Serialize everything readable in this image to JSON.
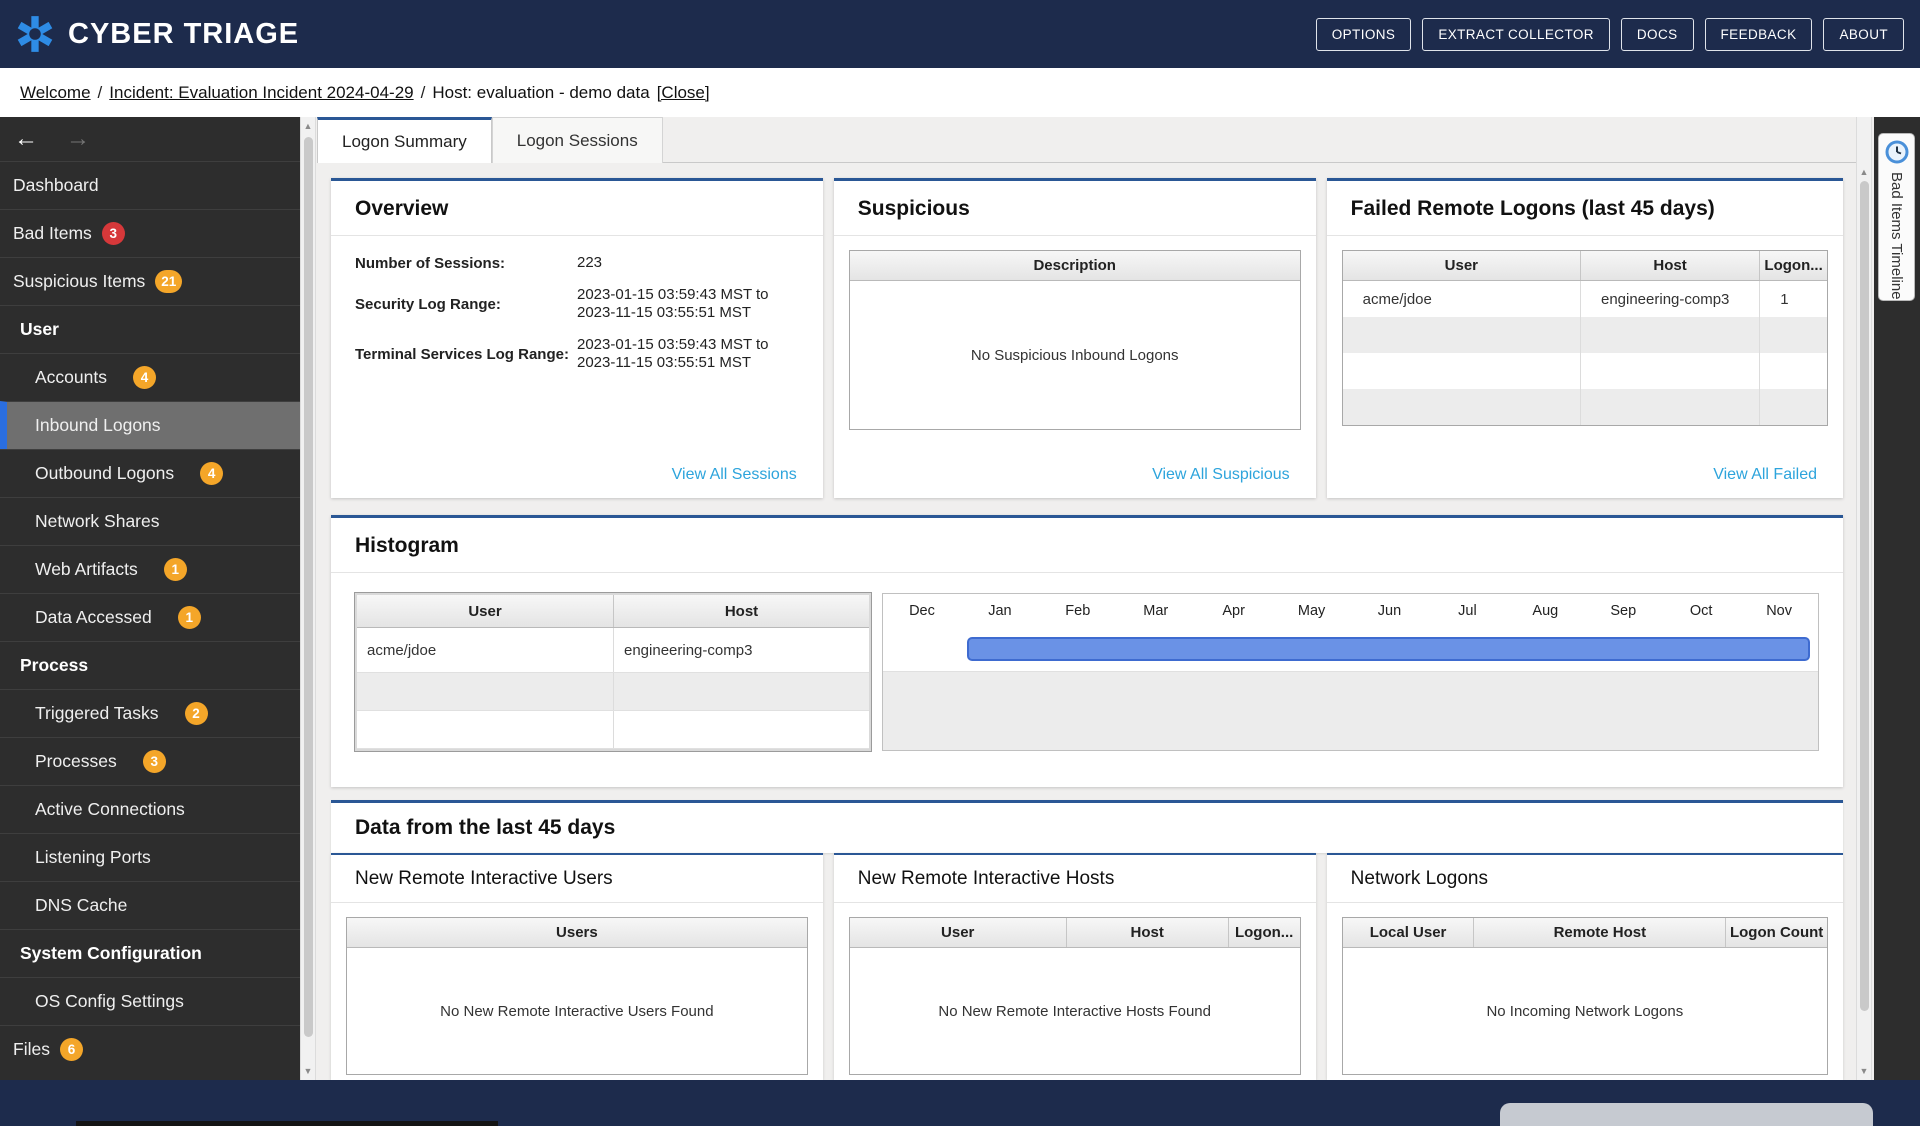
{
  "header": {
    "app_title": "CYBER TRIAGE",
    "buttons": [
      "OPTIONS",
      "EXTRACT COLLECTOR",
      "DOCS",
      "FEEDBACK",
      "ABOUT"
    ]
  },
  "breadcrumb": {
    "welcome": "Welcome",
    "separator": "/",
    "incident": "Incident: Evaluation Incident 2024-04-29",
    "host": "Host: evaluation - demo data",
    "close": "[Close]"
  },
  "sidebar_nav": {
    "back_icon": "←",
    "forward_icon": "→"
  },
  "sidebar": {
    "items": [
      {
        "label": "Dashboard",
        "kind": "top"
      },
      {
        "label": "Bad Items",
        "kind": "top",
        "badge": "3",
        "badgeColor": "red"
      },
      {
        "label": "Suspicious Items",
        "kind": "top",
        "badge": "21",
        "badgeColor": "orange"
      },
      {
        "label": "User",
        "kind": "section"
      },
      {
        "label": "Accounts",
        "kind": "sub",
        "indent": true,
        "badge": "4",
        "badgeColor": "orange"
      },
      {
        "label": "Inbound Logons",
        "kind": "sub",
        "indent": true,
        "selected": true
      },
      {
        "label": "Outbound Logons",
        "kind": "sub",
        "indent": true,
        "badge": "4",
        "badgeColor": "orange"
      },
      {
        "label": "Network Shares",
        "kind": "sub",
        "indent": true
      },
      {
        "label": "Web Artifacts",
        "kind": "sub",
        "indent": true,
        "badge": "1",
        "badgeColor": "orange"
      },
      {
        "label": "Data Accessed",
        "kind": "sub",
        "indent": true,
        "badge": "1",
        "badgeColor": "orange"
      },
      {
        "label": "Process",
        "kind": "section"
      },
      {
        "label": "Triggered Tasks",
        "kind": "sub",
        "indent": true,
        "badge": "2",
        "badgeColor": "orange"
      },
      {
        "label": "Processes",
        "kind": "sub",
        "indent": true,
        "badge": "3",
        "badgeColor": "orange"
      },
      {
        "label": "Active Connections",
        "kind": "sub",
        "indent": true
      },
      {
        "label": "Listening Ports",
        "kind": "sub",
        "indent": true
      },
      {
        "label": "DNS Cache",
        "kind": "sub",
        "indent": true
      },
      {
        "label": "System Configuration",
        "kind": "section"
      },
      {
        "label": "OS Config Settings",
        "kind": "sub",
        "indent": true
      },
      {
        "label": "Files",
        "kind": "top",
        "badge": "6",
        "badgeColor": "orange"
      }
    ]
  },
  "tabs": [
    {
      "label": "Logon Summary",
      "active": true
    },
    {
      "label": "Logon Sessions",
      "active": false
    }
  ],
  "panels": {
    "overview": {
      "title": "Overview",
      "fields": [
        {
          "label": "Number of Sessions:",
          "lines": [
            "223"
          ]
        },
        {
          "label": "Security Log Range:",
          "lines": [
            "2023-01-15 03:59:43 MST to",
            "2023-11-15 03:55:51 MST"
          ]
        },
        {
          "label": "Terminal Services Log Range:",
          "lines": [
            "2023-01-15 03:59:43 MST to",
            "2023-11-15 03:55:51 MST"
          ]
        }
      ],
      "link": "View All Sessions"
    },
    "suspicious": {
      "title": "Suspicious",
      "columns": [
        "Description"
      ],
      "empty": "No Suspicious Inbound Logons",
      "link": "View All Suspicious"
    },
    "failed": {
      "title": "Failed Remote Logons (last 45 days)",
      "columns": [
        "User",
        "Host",
        "Logon..."
      ],
      "rows": [
        [
          "acme/jdoe",
          "engineering-comp3",
          "1"
        ]
      ],
      "empty_row_count": 3,
      "link": "View All Failed"
    }
  },
  "histogram": {
    "title": "Histogram",
    "table": {
      "columns": [
        "User",
        "Host"
      ],
      "rows": [
        [
          "acme/jdoe",
          "engineering-comp3"
        ]
      ],
      "empty_row_count": 2
    },
    "months": [
      "Dec",
      "Jan",
      "Feb",
      "Mar",
      "Apr",
      "May",
      "Jun",
      "Jul",
      "Aug",
      "Sep",
      "Oct",
      "Nov"
    ],
    "bar": {
      "user": "acme/jdoe",
      "host": "engineering-comp3",
      "start_month": "Jan",
      "end_month": "Nov"
    }
  },
  "last45": {
    "title": "Data from the last 45 days",
    "panels": [
      {
        "title": "New Remote Interactive Users",
        "columns": [
          "Users"
        ],
        "empty": "No New Remote Interactive Users Found"
      },
      {
        "title": "New Remote Interactive Hosts",
        "columns": [
          "User",
          "Host",
          "Logon..."
        ],
        "empty": "No New Remote Interactive Hosts Found"
      },
      {
        "title": "Network Logons",
        "columns": [
          "Local User",
          "Remote Host",
          "Logon Count"
        ],
        "empty": "No Incoming Network Logons"
      }
    ]
  },
  "timeline_tab": {
    "label": "Bad Items Timeline"
  },
  "colors": {
    "header_navy": "#1d2b4c",
    "panel_accent_blue": "#2a5795",
    "link_blue": "#2da4dc",
    "badge_red": "#d6383a",
    "badge_orange": "#f4a629",
    "selected_item_blue": "#2a6ee0",
    "histogram_bar_fill": "#6a92e6",
    "histogram_bar_border": "#3e6bd0"
  }
}
